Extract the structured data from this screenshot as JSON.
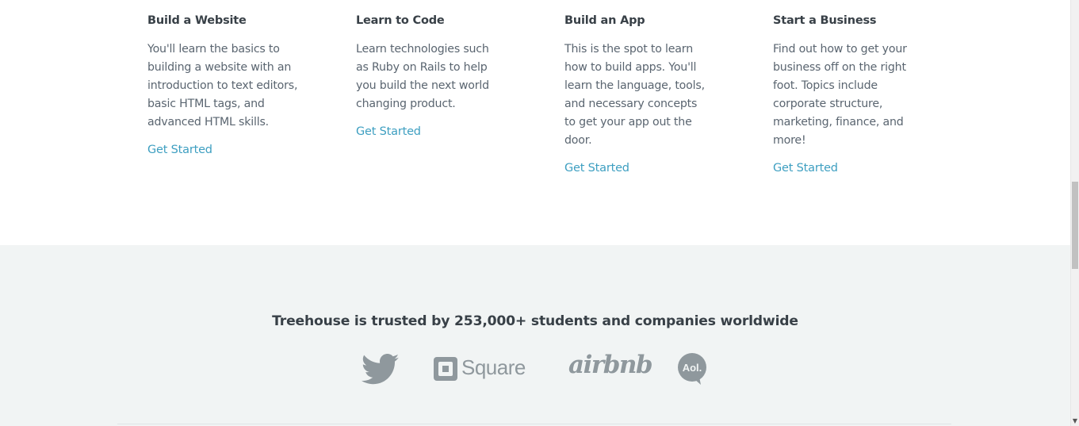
{
  "tracks": [
    {
      "title": "Build a Website",
      "description": "You'll learn the basics to building a website with an introduction to text editors, basic HTML tags, and advanced HTML skills.",
      "link": "Get Started"
    },
    {
      "title": "Learn to Code",
      "description": "Learn technologies such as Ruby on Rails to help you build the next world changing product.",
      "link": "Get Started"
    },
    {
      "title": "Build an App",
      "description": "This is the spot to learn how to build apps. You'll learn the language, tools, and necessary concepts to get your app out the door.",
      "link": "Get Started"
    },
    {
      "title": "Start a Business",
      "description": "Find out how to get your business off on the right foot. Topics include corporate structure, marketing, finance, and more!",
      "link": "Get Started"
    }
  ],
  "trusted": {
    "heading": "Treehouse is trusted by 253,000+ students and companies worldwide",
    "logos": {
      "twitter_icon": "twitter-logo",
      "square_text": "Square",
      "airbnb_text": "airbnb",
      "aol_text": "Aol."
    }
  },
  "colors": {
    "link": "#3e9fc1",
    "heading": "#384047",
    "band_background": "#f1f4f4",
    "logo_gray": "#8f989d"
  }
}
